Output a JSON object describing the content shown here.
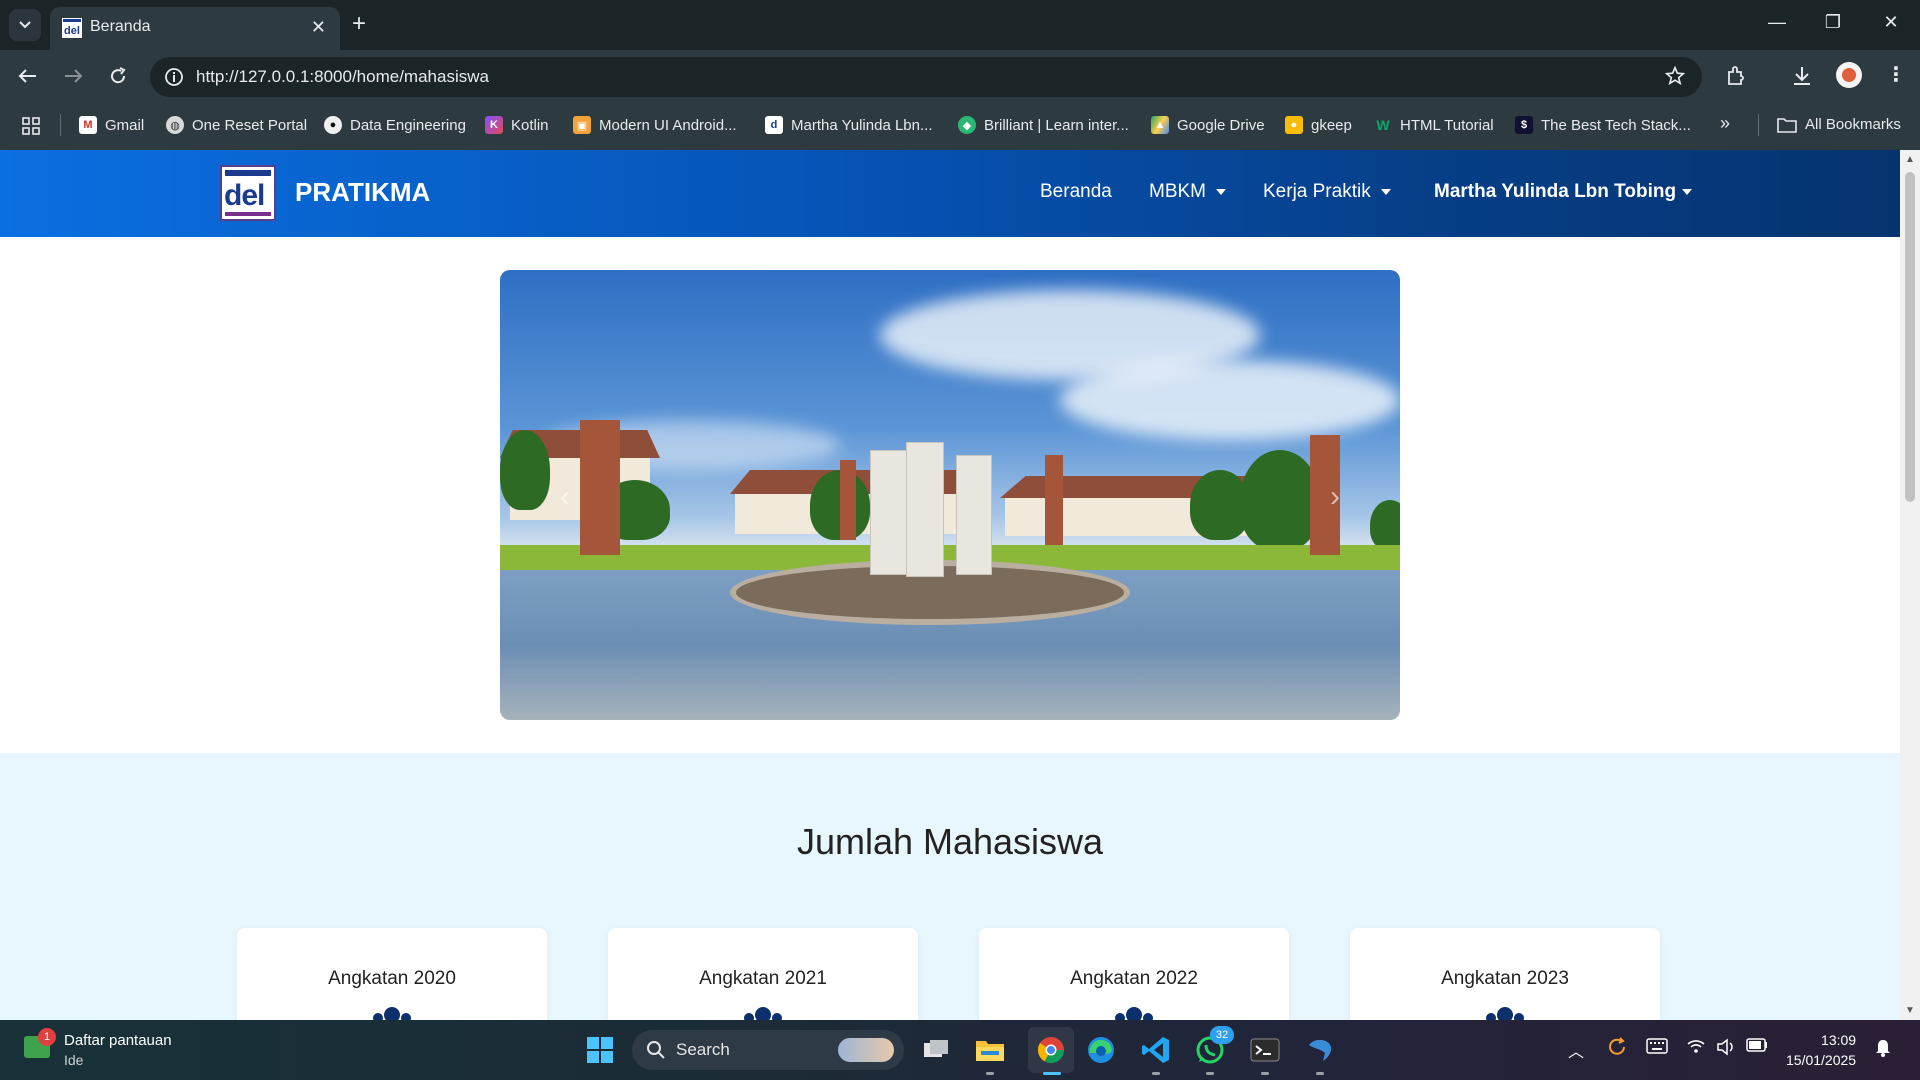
{
  "browser": {
    "tab_title": "Beranda",
    "url": "http://127.0.0.1:8000/home/mahasiswa",
    "bookmarks": [
      {
        "label": "Gmail",
        "icon": "gmail-icon"
      },
      {
        "label": "One Reset Portal",
        "icon": "globe-icon"
      },
      {
        "label": "Data Engineering",
        "icon": "github-icon"
      },
      {
        "label": "Kotlin",
        "icon": "kotlin-icon"
      },
      {
        "label": "Modern UI Android...",
        "icon": "android-icon"
      },
      {
        "label": "Martha Yulinda Lbn...",
        "icon": "del-icon"
      },
      {
        "label": "Brilliant | Learn inter...",
        "icon": "brilliant-icon"
      },
      {
        "label": "Google Drive",
        "icon": "drive-icon"
      },
      {
        "label": "gkeep",
        "icon": "keep-icon"
      },
      {
        "label": "HTML Tutorial",
        "icon": "w3-icon"
      },
      {
        "label": "The Best Tech Stack...",
        "icon": "techstack-icon"
      }
    ],
    "all_bookmarks": "All Bookmarks"
  },
  "site": {
    "logo_text": "del",
    "name": "PRATIKMA",
    "nav": {
      "beranda": "Beranda",
      "mbkm": "MBKM",
      "kerja_praktik": "Kerja Praktik",
      "user": "Martha Yulinda Lbn Tobing"
    }
  },
  "stats": {
    "title": "Jumlah Mahasiswa",
    "cards": [
      {
        "label": "Angkatan 2020"
      },
      {
        "label": "Angkatan 2021"
      },
      {
        "label": "Angkatan 2022"
      },
      {
        "label": "Angkatan 2023"
      }
    ]
  },
  "taskbar": {
    "watchlist_title": "Daftar pantauan",
    "watchlist_sub": "Ide",
    "watchlist_badge": "1",
    "search_placeholder": "Search",
    "whatsapp_badge": "32",
    "time": "13:09",
    "date": "15/01/2025"
  },
  "colors": {
    "nav_gradient_start": "#0a6fe0",
    "nav_gradient_end": "#05336e",
    "stats_bg": "#e8f7fd",
    "people_icon": "#0d2f6b"
  }
}
